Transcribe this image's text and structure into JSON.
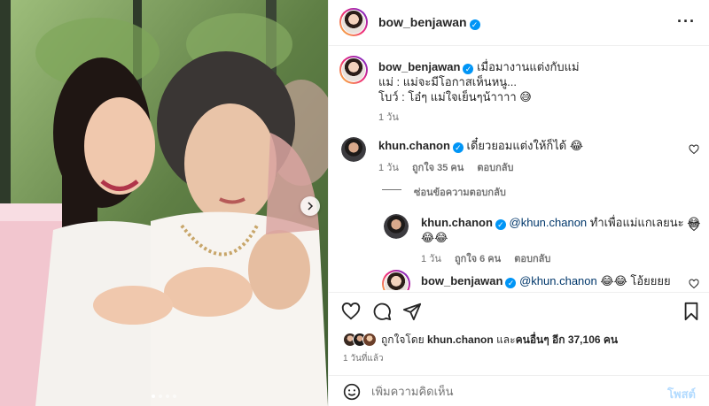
{
  "post": {
    "author": "bow_benjawan",
    "verified": true,
    "more_icon": "more-horizontal-icon",
    "caption": {
      "username": "bow_benjawan",
      "line1": "เมื่อมางานแต่งกับแม่",
      "line2": "แม่ : แม่จะมีโอกาสเห็นหนู...",
      "line3": "โบว์ : โอ๋ๆ แม่ใจเย็นๆน้าาาา 😅",
      "time": "1 วัน"
    },
    "comments": [
      {
        "username": "khun.chanon",
        "text": "เดี๋ยวยอมแต่งให้ก็ได้ 😂",
        "time": "1 วัน",
        "likes": "ถูกใจ 35 คน",
        "reply": "ตอบกลับ",
        "hide_replies": "ซ่อนข้อความตอบกลับ",
        "replies": [
          {
            "username": "khun.chanon",
            "mention": "@khun.chanon",
            "text": "ทำเพื่อแม่แกเลยนะ 😂",
            "text2": "😂😂",
            "time": "1 วัน",
            "likes": "ถูกใจ 6 คน",
            "reply": "ตอบกลับ"
          },
          {
            "username": "bow_benjawan",
            "mention": "@khun.chanon",
            "text": "😂😂 โอ้ยยยย"
          }
        ]
      }
    ],
    "liked_by": {
      "prefix": "ถูกใจโดย",
      "user": "khun.chanon",
      "and": "และ",
      "others": "คนอื่นๆ อีก 37,106 คน"
    },
    "posted_ago": "1 วันที่แล้ว",
    "add_comment": {
      "placeholder": "เพิ่มความคิดเห็น",
      "post_label": "โพสต์"
    },
    "carousel": {
      "total": 4,
      "active": 0
    }
  },
  "colors": {
    "accent": "#0095f6",
    "post_disabled": "#b3dbff",
    "mention": "#00376b"
  }
}
